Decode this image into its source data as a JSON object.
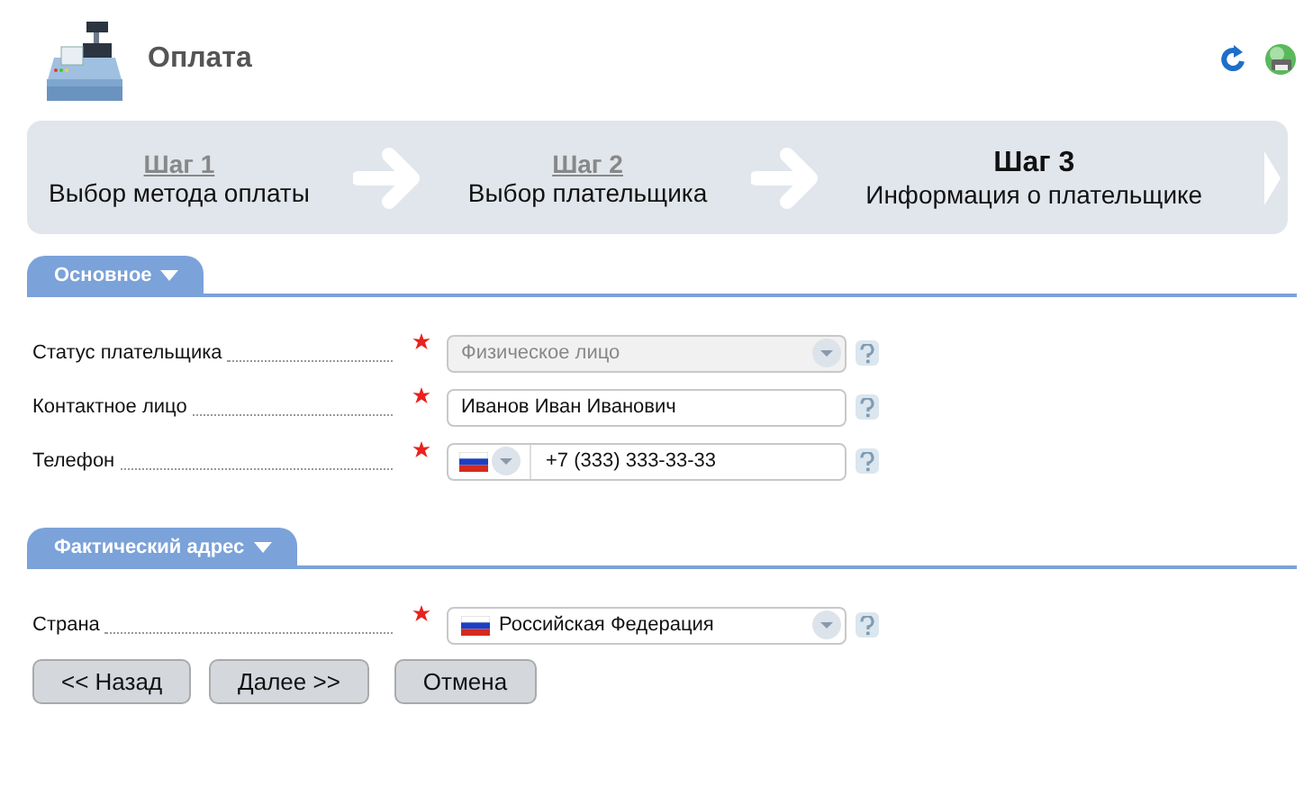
{
  "header": {
    "title": "Оплата"
  },
  "steps": [
    {
      "label": "Шаг 1",
      "description": "Выбор метода оплаты",
      "selected": false
    },
    {
      "label": "Шаг 2",
      "description": "Выбор плательщика",
      "selected": false
    },
    {
      "label": "Шаг 3",
      "description": "Информация о плательщике",
      "selected": true
    }
  ],
  "sections": [
    {
      "title": "Основное",
      "fields": [
        {
          "kind": "select",
          "label": "Статус плательщика",
          "required": true,
          "value": "Физическое лицо",
          "disabled": true,
          "flag": false
        },
        {
          "kind": "text",
          "label": "Контактное лицо",
          "required": true,
          "value": "Иванов Иван Иванович",
          "disabled": false
        },
        {
          "kind": "phone",
          "label": "Телефон",
          "required": true,
          "value": "+7 (333) 333-33-33",
          "disabled": false
        }
      ]
    },
    {
      "title": "Фактический адрес",
      "fields": [
        {
          "kind": "select",
          "label": "Страна",
          "required": true,
          "value": "Российская Федерация",
          "disabled": false,
          "flag": true
        }
      ]
    }
  ],
  "buttons": [
    "<< Назад",
    "Далее >>",
    "Отмена"
  ]
}
